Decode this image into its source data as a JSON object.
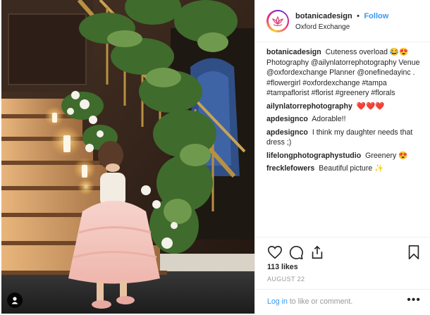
{
  "post": {
    "username": "botanicadesign",
    "separator": "•",
    "follow_label": "Follow",
    "location": "Oxford Exchange",
    "comments": [
      {
        "user": "botanicadesign",
        "text": "Cuteness overload 😂😍 Photography @ailynlatorrephotography Venue @oxfordexchange Planner @onefinedayinc . #flowergirl #oxfordexchange #tampa #tampaflorist #florist #greenery #florals"
      },
      {
        "user": "ailynlatorrephotography",
        "text": "❤️❤️❤️"
      },
      {
        "user": "apdesignco",
        "text": "Adorable!!"
      },
      {
        "user": "apdesignco",
        "text": "I think my daughter needs that dress ;)"
      },
      {
        "user": "lifelongphotographystudio",
        "text": "Greenery 😍"
      },
      {
        "user": "frecklefowers",
        "text": "Beautiful picture ✨"
      }
    ],
    "likes": "113 likes",
    "date": "AUGUST 22",
    "login_link": "Log in",
    "login_text": " to like or comment.",
    "more_label": "•••"
  },
  "icons": {
    "avatar": "lotus-logo-icon",
    "like": "heart-icon",
    "comment": "comment-bubble-icon",
    "share": "share-icon",
    "save": "bookmark-icon",
    "tag": "user-tag-icon"
  },
  "colors": {
    "link": "#3897f0",
    "text": "#262626",
    "muted": "#999999"
  }
}
